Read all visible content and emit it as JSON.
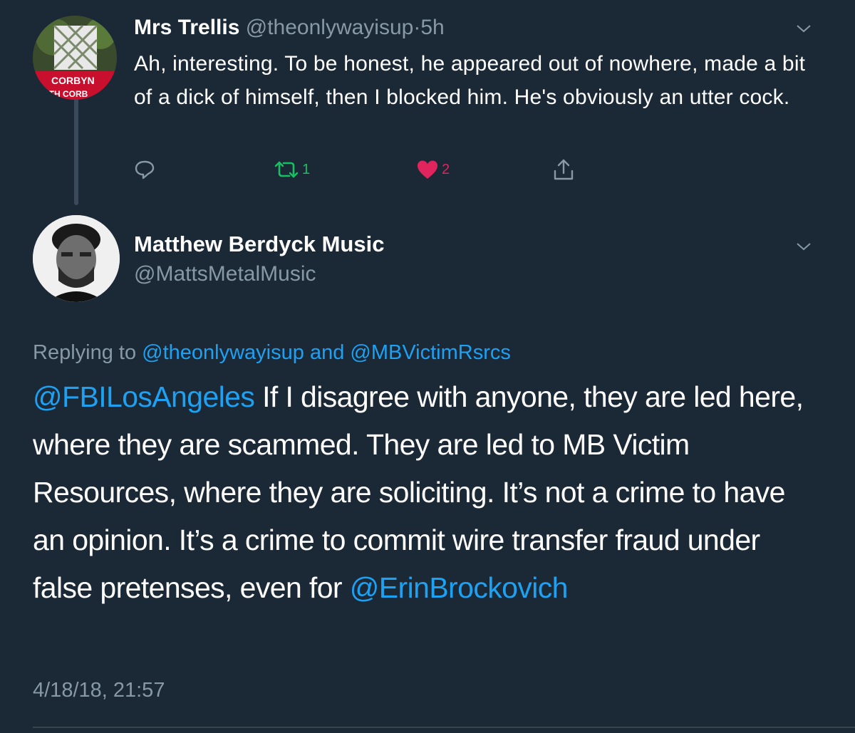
{
  "tweet1": {
    "name": "Mrs Trellis",
    "handle": "@theonlywayisup",
    "dot": "·",
    "time": "5h",
    "body": "Ah, interesting. To be honest, he appeared out of nowhere, made a bit of a dick of himself, then I blocked him. He's obviously an utter cock.",
    "avatar_text_1": "CORBYN",
    "avatar_text_2": "WITH CORB",
    "actions": {
      "reply_icon": "reply-icon",
      "retweet_icon": "retweet-icon",
      "retweet_count": "1",
      "like_icon": "heart-icon",
      "like_count": "2",
      "share_icon": "share-icon"
    }
  },
  "tweet2": {
    "name": "Matthew Berdyck Music",
    "handle": "@MattsMetalMusic",
    "replying_prefix": "Replying to",
    "replying_to_1": "@theonlywayisup",
    "replying_and": "and",
    "replying_to_2": "@MBVictimRsrcs",
    "mention_start": "@FBILosAngeles",
    "body_text": " If I disagree with anyone, they are led here, where they are scammed. They are led to MB Victim Resources, where they are soliciting. It’s not a crime to have an opinion. It’s a crime to commit wire transfer fraud under false pretenses, even for ",
    "mention_end": "@ErinBrockovich",
    "timestamp": "4/18/18, 21:57"
  },
  "colors": {
    "background": "#1b2836",
    "secondary_text": "#8899a6",
    "link": "#1da1f2",
    "retweet": "#17bf63",
    "like": "#e0245e"
  }
}
